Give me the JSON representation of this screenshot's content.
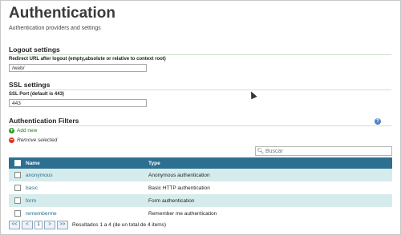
{
  "page": {
    "title": "Authentication",
    "subtitle": "Authentication providers and settings"
  },
  "logout": {
    "heading": "Logout settings",
    "label": "Redirect URL after logout (empty,absolute or relative to context root)",
    "value": "/web/"
  },
  "ssl": {
    "heading": "SSL settings",
    "label": "SSL Port (default is 443)",
    "value": "443"
  },
  "filters": {
    "heading": "Authentication Filters",
    "help_icon": "help-icon",
    "add_label": "Add new",
    "remove_label": "Remove selected",
    "search_placeholder": "Buscar",
    "columns": {
      "name": "Name",
      "type": "Type"
    },
    "rows": [
      {
        "name": "anonymous",
        "type": "Anonymous authentication"
      },
      {
        "name": "basic",
        "type": "Basic HTTP authentication"
      },
      {
        "name": "form",
        "type": "Form authentication"
      },
      {
        "name": "rememberme",
        "type": "Remember me authentication"
      }
    ],
    "pager": {
      "first": "<<",
      "prev": "<",
      "page": "1",
      "next": ">",
      "last": ">>",
      "result_text": "Resultados 1 a 4 (de un total de 4 items)"
    }
  },
  "colors": {
    "header_bg": "#2d6f91",
    "row_alt": "#d6ecec",
    "link": "#2b6f90",
    "section_line": "#cfe0c8"
  }
}
